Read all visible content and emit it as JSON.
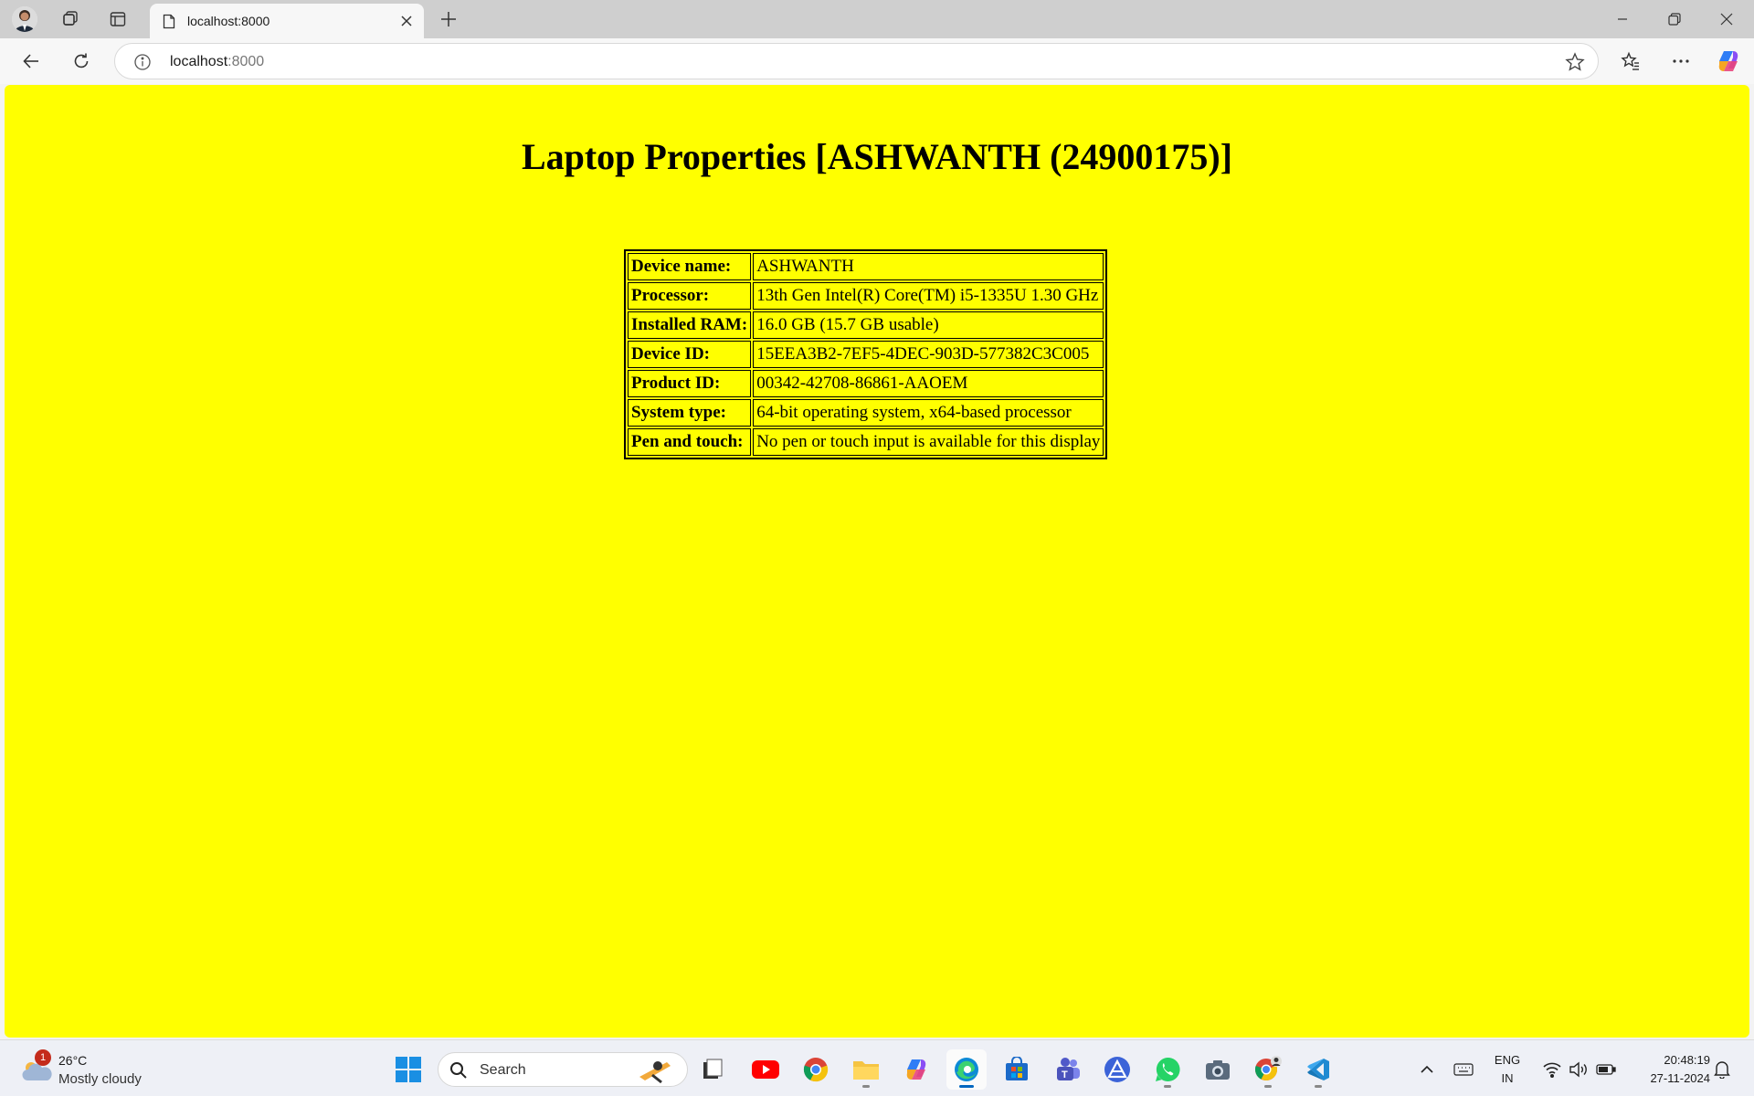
{
  "browser": {
    "tab_title": "localhost:8000",
    "url_host": "localhost",
    "url_port": ":8000"
  },
  "page": {
    "background": "#ffff00",
    "title": "Laptop Properties [ASHWANTH (24900175)]",
    "properties": [
      {
        "key": "Device name:",
        "value": "ASHWANTH"
      },
      {
        "key": "Processor:",
        "value": "13th Gen Intel(R) Core(TM) i5-1335U 1.30 GHz"
      },
      {
        "key": "Installed RAM:",
        "value": "16.0 GB (15.7 GB usable)"
      },
      {
        "key": "Device ID:",
        "value": "15EEA3B2-7EF5-4DEC-903D-577382C3C005"
      },
      {
        "key": "Product ID:",
        "value": "00342-42708-86861-AAOEM"
      },
      {
        "key": "System type:",
        "value": "64-bit operating system, x64-based processor"
      },
      {
        "key": "Pen and touch:",
        "value": "No pen or touch input is available for this display"
      }
    ]
  },
  "taskbar": {
    "weather_badge": "1",
    "temperature": "26°C",
    "condition": "Mostly cloudy",
    "search_placeholder": "Search",
    "language_line1": "ENG",
    "language_line2": "IN",
    "time": "20:48:19",
    "date": "27-11-2024",
    "apps": [
      "windows-start",
      "file-manager",
      "youtube",
      "chrome",
      "file-explorer",
      "copilot",
      "edge",
      "microsoft-store",
      "teams",
      "affinity",
      "whatsapp",
      "camera",
      "chrome-profile",
      "vscode"
    ]
  }
}
